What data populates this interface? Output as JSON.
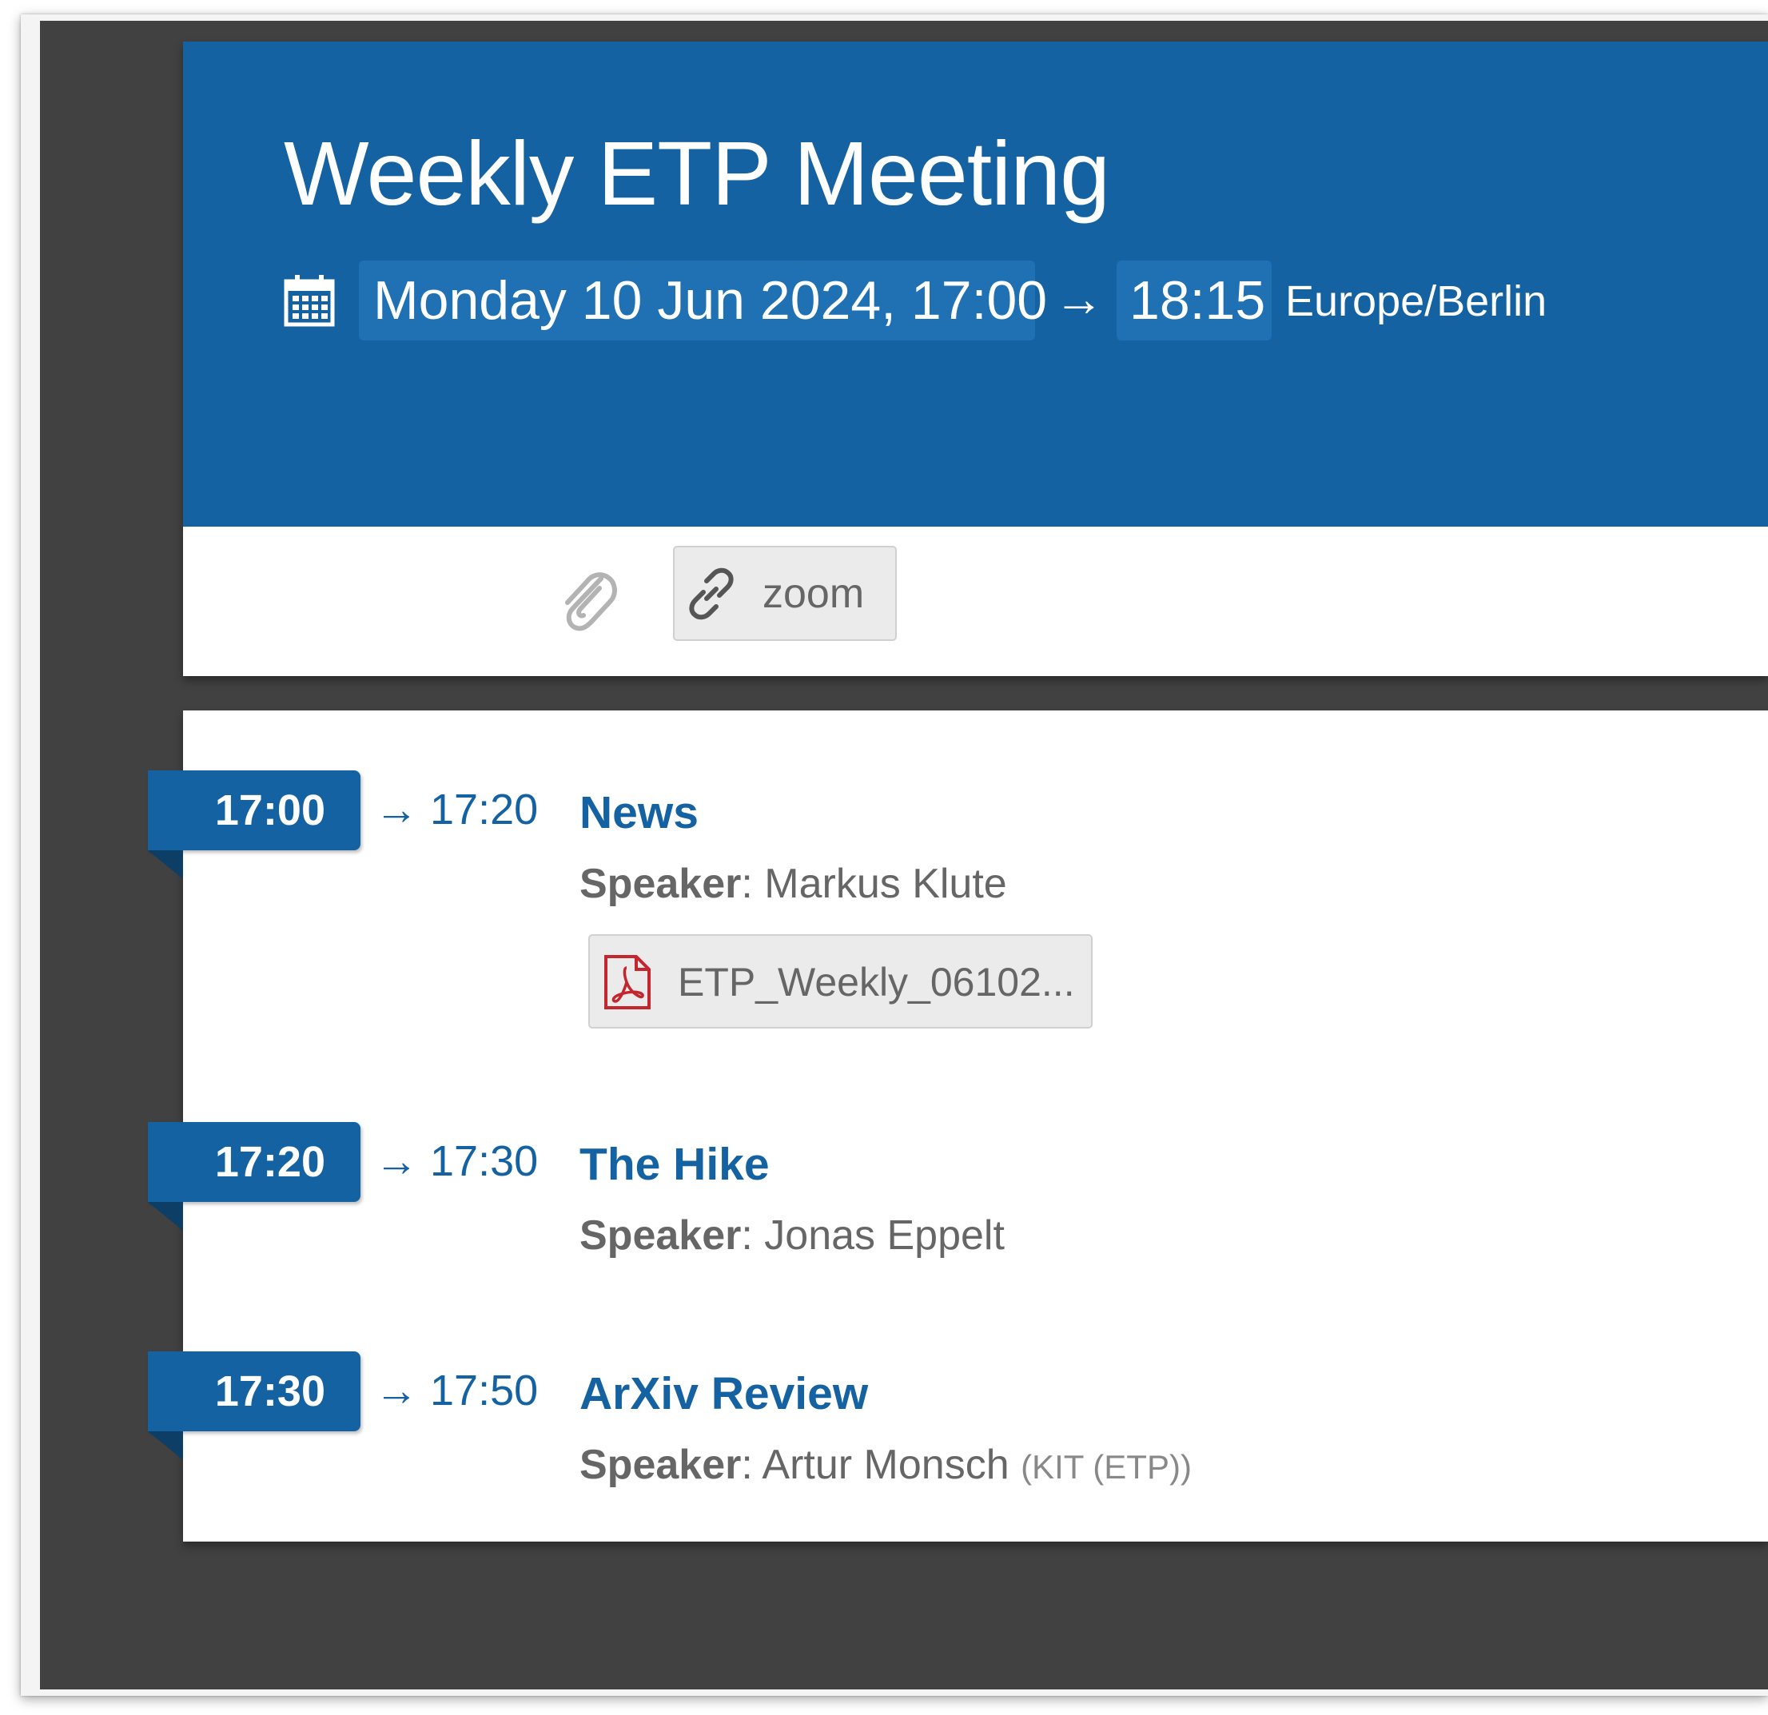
{
  "event": {
    "title": "Weekly ETP Meeting",
    "start": "Monday 10 Jun 2024, 17:00",
    "arrow": "→",
    "end": "18:15",
    "timezone": "Europe/Berlin"
  },
  "toolbar": {
    "zoom_label": "zoom"
  },
  "colors": {
    "header_blue": "#1562a2",
    "background_dark": "#414141"
  },
  "timetable": {
    "entries": [
      {
        "start": "17:00",
        "end": "→ 17:20",
        "title": "News",
        "speaker_key": "Speaker",
        "speaker_name": ": Markus Klute",
        "attachment": "ETP_Weekly_06102..."
      },
      {
        "start": "17:20",
        "end": "→ 17:30",
        "title": "The Hike",
        "speaker_key": "Speaker",
        "speaker_name": ": Jonas Eppelt"
      },
      {
        "start": "17:30",
        "end": "→ 17:50",
        "title": "ArXiv Review",
        "speaker_key": "Speaker",
        "speaker_name": ": Artur Monsch",
        "affiliation": "(KIT (ETP))"
      }
    ]
  }
}
